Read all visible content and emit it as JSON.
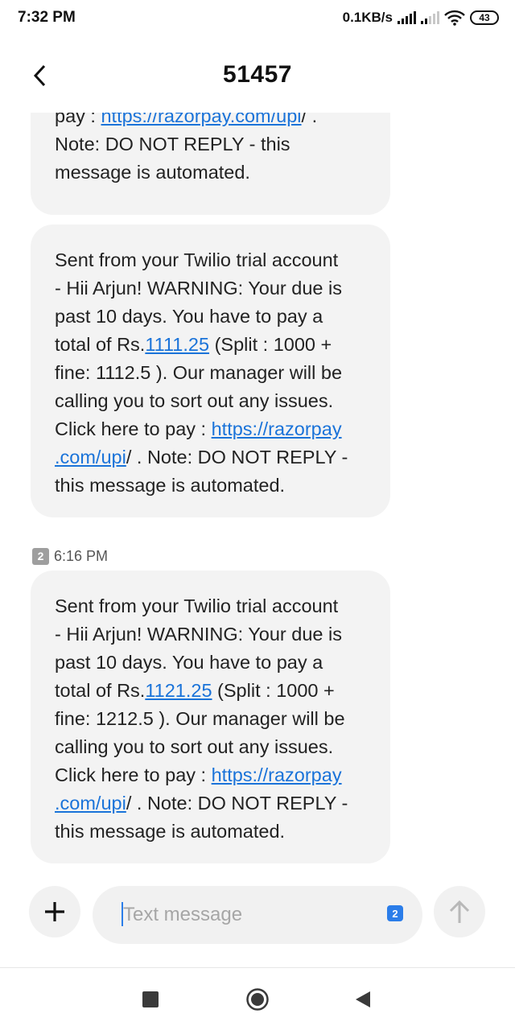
{
  "status_bar": {
    "time": "7:32 PM",
    "net_speed": "0.1KB/s",
    "battery_level": "43"
  },
  "header": {
    "title": "51457",
    "back_icon": "chevron-left-icon"
  },
  "messages": [
    {
      "lines": [
        {
          "pre": "pay : ",
          "link": "https://razorpay.com/upi",
          "post": "/ ."
        },
        {
          "pre": "Note: DO NOT REPLY - this",
          "link": "",
          "post": ""
        },
        {
          "pre": "message is automated.",
          "link": "",
          "post": ""
        }
      ]
    },
    {
      "lines": [
        {
          "pre": "Sent from your Twilio trial account",
          "link": "",
          "post": ""
        },
        {
          "pre": "- Hii Arjun! WARNING: Your due is",
          "link": "",
          "post": ""
        },
        {
          "pre": "past 10 days. You have to pay a",
          "link": "",
          "post": ""
        },
        {
          "pre": "total of Rs.",
          "link": "1111.25",
          "post": " (Split : 1000 +"
        },
        {
          "pre": "fine: 1112.5 ). Our manager will be",
          "link": "",
          "post": ""
        },
        {
          "pre": "calling you to sort out any issues.",
          "link": "",
          "post": ""
        },
        {
          "pre": "Click here to pay : ",
          "link": "https://razorpay",
          "post": ""
        },
        {
          "pre": "",
          "link": ".com/upi",
          "post": "/ . Note: DO NOT REPLY -"
        },
        {
          "pre": "this message is automated.",
          "link": "",
          "post": ""
        }
      ]
    },
    {
      "lines": [
        {
          "pre": "Sent from your Twilio trial account",
          "link": "",
          "post": ""
        },
        {
          "pre": "- Hii Arjun! WARNING: Your due is",
          "link": "",
          "post": ""
        },
        {
          "pre": "past 10 days. You have to pay a",
          "link": "",
          "post": ""
        },
        {
          "pre": "total of Rs.",
          "link": "1121.25",
          "post": " (Split : 1000 +"
        },
        {
          "pre": "fine: 1212.5 ). Our manager will be",
          "link": "",
          "post": ""
        },
        {
          "pre": "calling you to sort out any issues.",
          "link": "",
          "post": ""
        },
        {
          "pre": "Click here to pay : ",
          "link": "https://razorpay",
          "post": ""
        },
        {
          "pre": "",
          "link": ".com/upi",
          "post": "/ . Note: DO NOT REPLY -"
        },
        {
          "pre": "this message is automated.",
          "link": "",
          "post": ""
        }
      ]
    }
  ],
  "timestamp": {
    "sim": "2",
    "time": "6:16 PM"
  },
  "compose": {
    "placeholder": "Text message",
    "sim": "2",
    "add_icon": "plus-icon",
    "send_icon": "arrow-up-icon"
  },
  "colors": {
    "link": "#1a73d9",
    "bubble": "#f3f3f3",
    "accent": "#2b7de9"
  }
}
